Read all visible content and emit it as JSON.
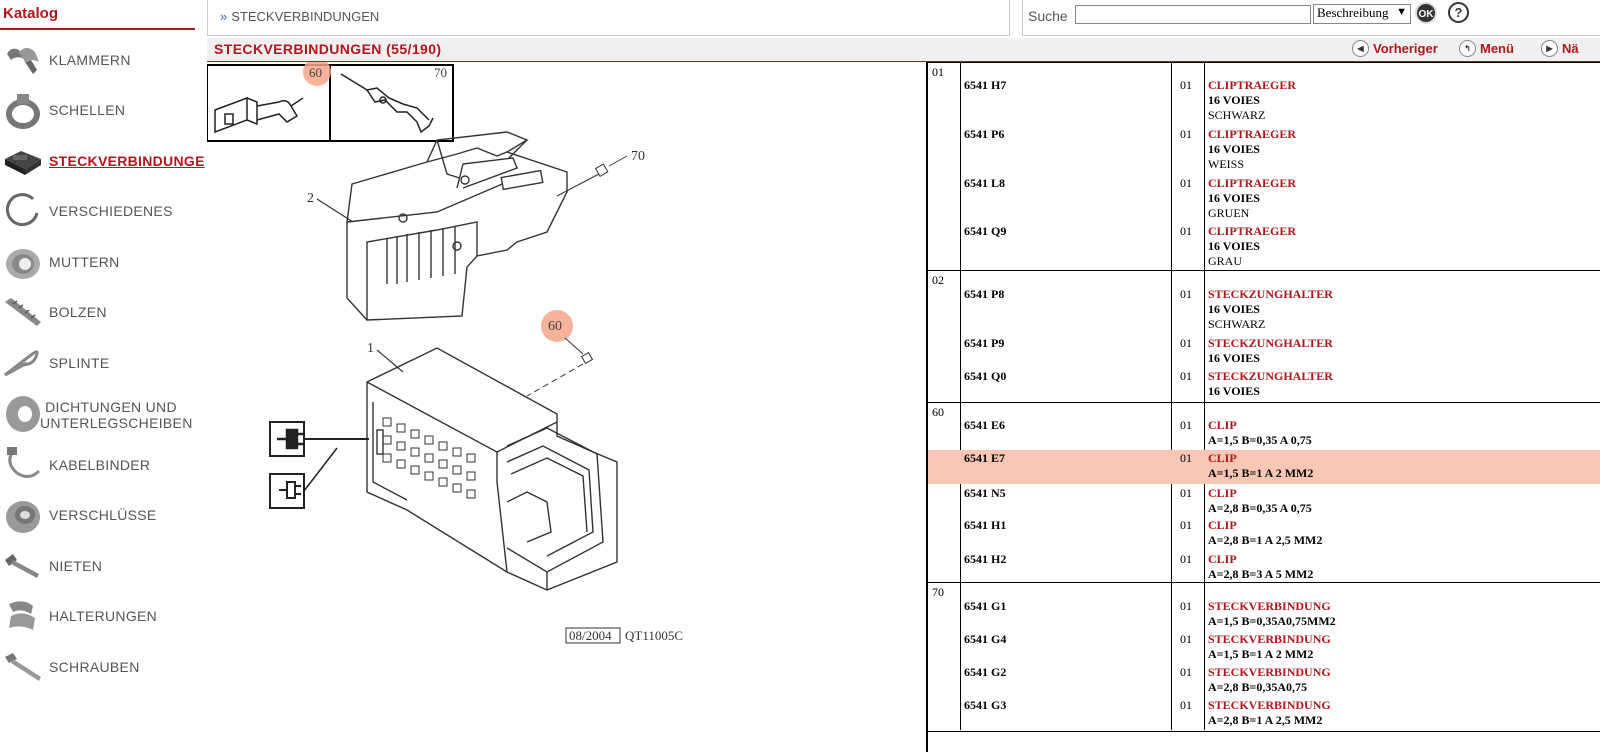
{
  "sidebar": {
    "title": "Katalog",
    "items": [
      {
        "label": "KLAMMERN",
        "icon": "clamp-icon",
        "active": false
      },
      {
        "label": "SCHELLEN",
        "icon": "hose-clamp-icon",
        "active": false
      },
      {
        "label": "STECKVERBINDUNGE",
        "icon": "connector-icon",
        "active": true
      },
      {
        "label": "VERSCHIEDENES",
        "icon": "ring-icon",
        "active": false
      },
      {
        "label": "MUTTERN",
        "icon": "nut-icon",
        "active": false
      },
      {
        "label": "BOLZEN",
        "icon": "bolt-icon",
        "active": false
      },
      {
        "label": "SPLINTE",
        "icon": "cotter-pin-icon",
        "active": false
      },
      {
        "label": "DICHTUNGEN UND",
        "label2": "UNTERLEGSCHEIBEN",
        "icon": "washer-icon",
        "active": false
      },
      {
        "label": "KABELBINDER",
        "icon": "cable-tie-icon",
        "active": false
      },
      {
        "label": "VERSCHLÜSSE",
        "icon": "plug-cap-icon",
        "active": false
      },
      {
        "label": "NIETEN",
        "icon": "rivet-icon",
        "active": false
      },
      {
        "label": "HALTERUNGEN",
        "icon": "bracket-icon",
        "active": false
      },
      {
        "label": "SCHRAUBEN",
        "icon": "screw-icon",
        "active": false
      }
    ]
  },
  "breadcrumb": {
    "marker": "»",
    "text": "STECKVERBINDUNGEN"
  },
  "search": {
    "label": "Suche",
    "value": "",
    "select_value": "Beschreibung",
    "ok_label": "OK",
    "help_label": "?"
  },
  "titlebar": {
    "title": "STECKVERBINDUNGEN (55/190)",
    "prev_label": "Vorheriger",
    "menu_label": "Menü",
    "next_label": "Nä"
  },
  "diagram": {
    "labels": [
      "60",
      "70",
      "70",
      "2",
      "60",
      "1"
    ],
    "stamp_date": "08/2004",
    "stamp_code": "QT11005C"
  },
  "parts": {
    "groups": [
      {
        "no": "01",
        "rows": [
          {
            "ref": "6541 H7",
            "qty": "01",
            "name": "CLIPTRAEGER",
            "line2": "16 VOIES",
            "line3": "SCHWARZ"
          },
          {
            "ref": "6541 P6",
            "qty": "01",
            "name": "CLIPTRAEGER",
            "line2": "16 VOIES",
            "line3": "WEISS"
          },
          {
            "ref": "6541 L8",
            "qty": "01",
            "name": "CLIPTRAEGER",
            "line2": "16 VOIES",
            "line3": "GRUEN"
          },
          {
            "ref": "6541 Q9",
            "qty": "01",
            "name": "CLIPTRAEGER",
            "line2": "16 VOIES",
            "line3": "GRAU"
          }
        ]
      },
      {
        "no": "02",
        "rows": [
          {
            "ref": "6541 P8",
            "qty": "01",
            "name": "STECKZUNGHALTER",
            "line2": "16 VOIES",
            "line3": "SCHWARZ"
          },
          {
            "ref": "6541 P9",
            "qty": "01",
            "name": "STECKZUNGHALTER",
            "line2": "16 VOIES",
            "line3": ""
          },
          {
            "ref": "6541 Q0",
            "qty": "01",
            "name": "STECKZUNGHALTER",
            "line2": "16 VOIES",
            "line3": ""
          }
        ]
      },
      {
        "no": "60",
        "rows": [
          {
            "ref": "6541 E6",
            "qty": "01",
            "name": "CLIP",
            "line2": "A=1,5 B=0,35 A 0,75",
            "line3": ""
          },
          {
            "ref": "6541 E7",
            "qty": "01",
            "name": "CLIP",
            "line2": "A=1,5 B=1 A 2 MM2",
            "line3": "",
            "highlight": true
          },
          {
            "ref": "6541 N5",
            "qty": "01",
            "name": "CLIP",
            "line2": "A=2,8 B=0,35 A 0,75",
            "line3": ""
          },
          {
            "ref": "6541 H1",
            "qty": "01",
            "name": "CLIP",
            "line2": "A=2,8 B=1 A 2,5 MM2",
            "line3": ""
          },
          {
            "ref": "6541 H2",
            "qty": "01",
            "name": "CLIP",
            "line2": "A=2,8 B=3 A 5 MM2",
            "line3": ""
          }
        ]
      },
      {
        "no": "70",
        "rows": [
          {
            "ref": "6541 G1",
            "qty": "01",
            "name": "STECKVERBINDUNG",
            "line2": "A=1,5 B=0,35A0,75MM2",
            "line3": ""
          },
          {
            "ref": "6541 G4",
            "qty": "01",
            "name": "STECKVERBINDUNG",
            "line2": "A=1,5 B=1 A 2 MM2",
            "line3": ""
          },
          {
            "ref": "6541 G2",
            "qty": "01",
            "name": "STECKVERBINDUNG",
            "line2": "A=2,8 B=0,35A0,75",
            "line3": ""
          },
          {
            "ref": "6541 G3",
            "qty": "01",
            "name": "STECKVERBINDUNG",
            "line2": "A=2,8 B=1 A 2,5 MM2",
            "line3": ""
          }
        ]
      }
    ]
  },
  "colors": {
    "brand": "#b0161b",
    "highlight": "#f8c6b4",
    "callout": "#f4a58a"
  }
}
